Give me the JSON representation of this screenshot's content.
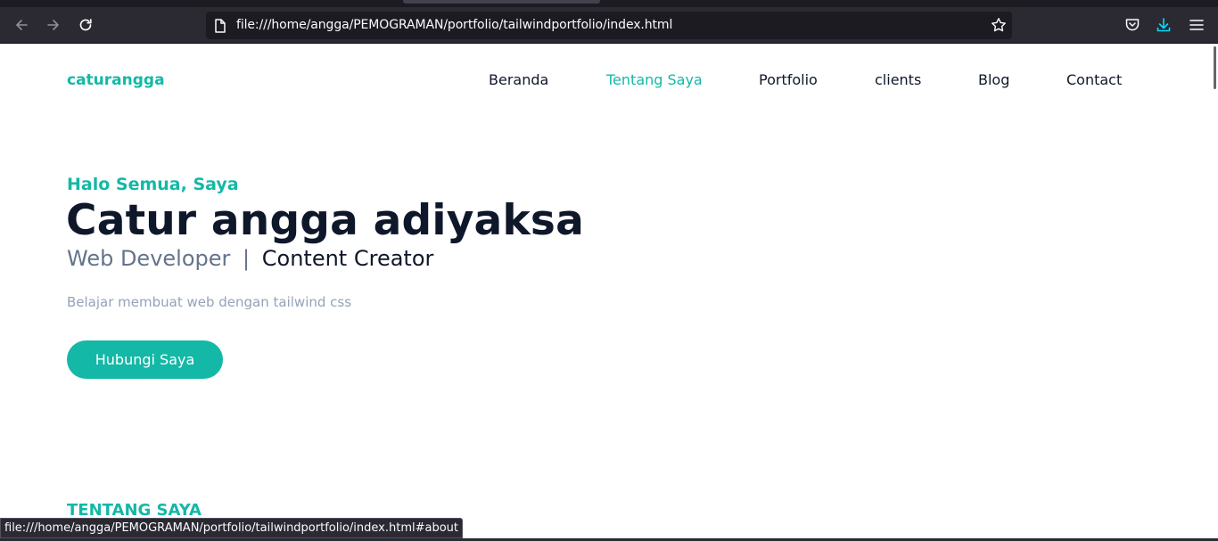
{
  "browser": {
    "url": "file:///home/angga/PEMOGRAMAN/portfolio/tailwindportfolio/index.html",
    "status_url": "file:///home/angga/PEMOGRAMAN/portfolio/tailwindportfolio/index.html#about",
    "icons": [
      "back-arrow-icon",
      "forward-arrow-icon",
      "reload-icon",
      "page-icon",
      "bookmark-star-icon",
      "pocket-icon",
      "download-icon",
      "menu-hamburger-icon"
    ],
    "accent": "#0df"
  },
  "site": {
    "brand": "caturangga",
    "nav": [
      {
        "label": "Beranda",
        "active": false
      },
      {
        "label": "Tentang Saya",
        "active": true
      },
      {
        "label": "Portfolio",
        "active": false
      },
      {
        "label": "clients",
        "active": false
      },
      {
        "label": "Blog",
        "active": false
      },
      {
        "label": "Contact",
        "active": false
      }
    ],
    "colors": {
      "primary": "#14b8a6",
      "dark": "#0f172a",
      "secondary": "#64748b"
    }
  },
  "hero": {
    "greeting": "Halo Semua, Saya",
    "name": "Catur angga adiyaksa",
    "role1": "Web Developer",
    "separator": "|",
    "role2": "Content Creator",
    "tagline": "Belajar membuat web dengan tailwind css",
    "cta_label": "Hubungi Saya"
  },
  "about": {
    "title": "TENTANG SAYA"
  }
}
